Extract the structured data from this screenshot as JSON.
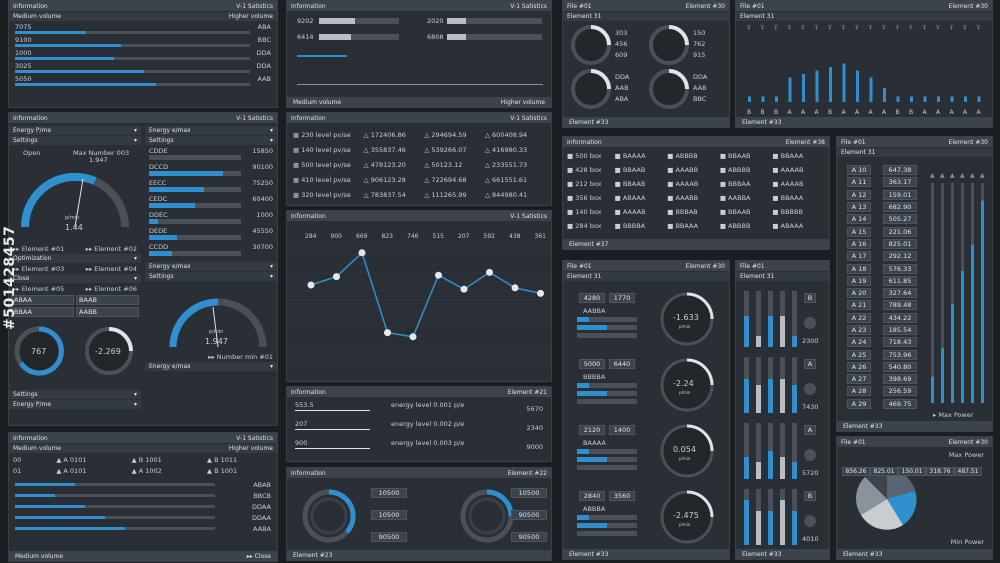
{
  "theme": {
    "accent": "#2f8fcf",
    "panel": "#2a2f35",
    "header": "#3c434b",
    "bg": "#1a1d21"
  },
  "p1": {
    "title": "Information",
    "tag": "V-1 Satistics",
    "sub_left": "Medium volume",
    "sub_right": "Higher volume",
    "foot_left": "Medium volume",
    "foot_right": "Higher volume",
    "rows": [
      {
        "label": "7075",
        "code": "ABA",
        "fill": 0.3
      },
      {
        "label": "9100",
        "code": "BBC",
        "fill": 0.45
      },
      {
        "label": "1000",
        "code": "DDA",
        "fill": 0.42
      },
      {
        "label": "3025",
        "code": "DDA",
        "fill": 0.55
      },
      {
        "label": "5050",
        "code": "AAB",
        "fill": 0.6
      }
    ]
  },
  "p2": {
    "title": "Information",
    "tag": "V-1 Satistics",
    "v1": "9202",
    "v2": "6414",
    "v3": "2020",
    "v4": "6808",
    "foot_left": "Medium volume",
    "foot_right": "Higher volume"
  },
  "p3": {
    "title": "File #01",
    "tag": "Element #30",
    "sub": "Element 31",
    "foot": "Element #33",
    "dials": [
      {
        "a": "303",
        "b": "456",
        "c": "609"
      },
      {
        "a": "150",
        "b": "762",
        "c": "915"
      },
      {
        "a": "DDA",
        "b": "AAB",
        "c": "ABA"
      },
      {
        "a": "DDA",
        "b": "AAB",
        "c": "BBC"
      }
    ]
  },
  "p4": {
    "title": "File #01",
    "tag": "Element #30",
    "sub": "Element 31",
    "foot": "Element #33",
    "xlabels": [
      "B",
      "B",
      "B",
      "A",
      "A",
      "A",
      "B",
      "A",
      "A",
      "A",
      "A",
      "B",
      "B",
      "A",
      "A",
      "A",
      "A",
      "A"
    ],
    "values": [
      0.08,
      0.08,
      0.08,
      0.35,
      0.4,
      0.45,
      0.5,
      0.55,
      0.45,
      0.35,
      0.2,
      0.08,
      0.08,
      0.08,
      0.08,
      0.08,
      0.08,
      0.08
    ]
  },
  "p5": {
    "title": "Information",
    "tag": "V-1 Satistics",
    "energy_pme": "Energy P/me",
    "energy_emax": "Energy e/max",
    "settings": "Settings",
    "open": "Open",
    "max_label": "Max Number 003",
    "max_val": "1.947",
    "gauge_unit": "p/min",
    "gauge_val": "1.44",
    "el01": "Element #01",
    "el02": "Element #02",
    "optimization": "Optimization",
    "el03": "Element #03",
    "el04": "Element #04",
    "close": "Close",
    "el05": "Element #05",
    "el06": "Element #06",
    "codes": [
      "ABAA",
      "BAAB",
      "BBAA",
      "AABB"
    ],
    "dial1": "767",
    "dial2": "-2.269",
    "settings2": "Settings",
    "energy_pme2": "Energy P/me",
    "list": [
      {
        "label": "CDDE",
        "val": "15850",
        "fill": 0.0
      },
      {
        "label": "DCCD",
        "val": "90100",
        "fill": 0.8
      },
      {
        "label": "EECC",
        "val": "75250",
        "fill": 0.6
      },
      {
        "label": "CEDC",
        "val": "60400",
        "fill": 0.5
      },
      {
        "label": "DDEC",
        "val": "1000",
        "fill": 0.1
      },
      {
        "label": "DEDE",
        "val": "45550",
        "fill": 0.3
      },
      {
        "label": "CCDD",
        "val": "30700",
        "fill": 0.25
      }
    ],
    "gauge2_val": "1.947",
    "gauge2_unit": "p/min",
    "number_min": "Number min #01",
    "energy_emax2": "Energy e/max"
  },
  "p6": {
    "title": "Information",
    "tag": "V-1 Satistics",
    "rows": [
      {
        "a": "230",
        "a_unit": "level pv/se",
        "b": "172406.86",
        "c": "294694.59",
        "d": "600408.94"
      },
      {
        "a": "140",
        "a_unit": "level pv/se",
        "b": "355837.46",
        "c": "539266.07",
        "d": "416980.33"
      },
      {
        "a": "500",
        "a_unit": "level pv/se",
        "b": "478123.20",
        "c": "50123.12",
        "d": "233551.73"
      },
      {
        "a": "410",
        "a_unit": "level pv/se",
        "b": "906123.28",
        "c": "722694.68",
        "d": "661551.61"
      },
      {
        "a": "320",
        "a_unit": "level pv/se",
        "b": "783837.54",
        "c": "111265.99",
        "d": "844980.41"
      }
    ]
  },
  "p7": {
    "title": "Information",
    "tag": "V-1 Satistics"
  },
  "chart_data": {
    "type": "line",
    "categories": [
      "284",
      "900",
      "669",
      "823",
      "746",
      "515",
      "207",
      "592",
      "438",
      "361"
    ],
    "values": [
      0.55,
      0.61,
      0.78,
      0.21,
      0.18,
      0.62,
      0.52,
      0.64,
      0.53,
      0.49
    ],
    "ylim": [
      0,
      1
    ],
    "grid": true
  },
  "p8": {
    "title": "Information",
    "tag": "Element #21",
    "rows": [
      {
        "left": "553.5",
        "mid": "energy level 0.001 p/e",
        "right": "5670"
      },
      {
        "left": "207",
        "mid": "energy level 0.002 p/e",
        "right": "2340"
      },
      {
        "left": "900",
        "mid": "energy level 0.003 p/e",
        "right": "9000"
      }
    ]
  },
  "p9": {
    "title": "Information",
    "tag": "Element #22",
    "foot": "Element #23",
    "boxes": [
      "10500",
      "10500",
      "90500",
      "10500",
      "90500",
      "90500"
    ]
  },
  "p10": {
    "title": "Information",
    "tag": "Element #38",
    "foot": "Element #37",
    "rows": [
      [
        "500 box",
        "BAAAA",
        "ABBBB",
        "BBAAB",
        "BBAAA"
      ],
      [
        "428 box",
        "BBAAB",
        "AAABB",
        "ABBBB",
        "AAAAB"
      ],
      [
        "212 box",
        "BBAAB",
        "AAAAB",
        "BBBAA",
        "AAAAB"
      ],
      [
        "356 box",
        "ABAAA",
        "AAABB",
        "AABBA",
        "BBAAA"
      ],
      [
        "140 box",
        "AAAAB",
        "BBBAB",
        "BBAAB",
        "BBBBB"
      ],
      [
        "284 box",
        "BBBBA",
        "BBAAA",
        "ABBBB",
        "ABAAA"
      ]
    ]
  },
  "p11": {
    "title": "File #01",
    "tag": "Element #30",
    "sub": "Element 31",
    "foot": "Element #33",
    "groups": [
      {
        "a": "4280",
        "b": "1770",
        "code": "AABBA",
        "dial": "-1.633",
        "unit": "p/min"
      },
      {
        "a": "5000",
        "b": "6440",
        "code": "BBBBA",
        "dial": "-2.24",
        "unit": "p/min"
      },
      {
        "a": "2120",
        "b": "1400",
        "code": "BAAAA",
        "dial": "0.054",
        "unit": "p/min"
      },
      {
        "a": "2840",
        "b": "3560",
        "code": "ABBBA",
        "dial": "-2.475",
        "unit": "p/min"
      }
    ]
  },
  "p12": {
    "title": "File #01",
    "sub": "Element 31",
    "foot": "Element #33",
    "tags": [
      "B",
      "A",
      "A",
      "B"
    ],
    "values": [
      "2300",
      "7430",
      "5720",
      "4010"
    ]
  },
  "p13": {
    "title": "File #01",
    "tag": "Element #30",
    "sub": "Element 31",
    "foot": "Element #33",
    "legend": "Max Power",
    "rows": [
      {
        "k": "A 10",
        "v": "647.38"
      },
      {
        "k": "A 11",
        "v": "363.17"
      },
      {
        "k": "A 12",
        "v": "159.01"
      },
      {
        "k": "A 13",
        "v": "682.90"
      },
      {
        "k": "A 14",
        "v": "505.27"
      },
      {
        "k": "A 15",
        "v": "221.06"
      },
      {
        "k": "A 16",
        "v": "825.01"
      },
      {
        "k": "A 17",
        "v": "292.12"
      },
      {
        "k": "A 18",
        "v": "576.33"
      },
      {
        "k": "A 19",
        "v": "611.85"
      },
      {
        "k": "A 20",
        "v": "327.64"
      },
      {
        "k": "A 21",
        "v": "789.48"
      },
      {
        "k": "A 22",
        "v": "434.22"
      },
      {
        "k": "A 23",
        "v": "185.54"
      },
      {
        "k": "A 24",
        "v": "718.43"
      },
      {
        "k": "A 25",
        "v": "753.96"
      },
      {
        "k": "A 26",
        "v": "540.80"
      },
      {
        "k": "A 27",
        "v": "398.69"
      },
      {
        "k": "A 28",
        "v": "256.59"
      },
      {
        "k": "A 29",
        "v": "469.75"
      }
    ],
    "bars": [
      0.12,
      0.25,
      0.45,
      0.6,
      0.72,
      0.92
    ]
  },
  "p14": {
    "title": "File #01",
    "tag": "Element #30",
    "foot": "Element #33",
    "max": "Max Power",
    "min": "Min Power",
    "values": [
      "856.26",
      "825.01",
      "150.01",
      "318.76",
      "487.51"
    ]
  },
  "p15": {
    "title": "Information",
    "tag": "V-1 Satistics",
    "sub_left": "Medium volume",
    "sub_right": "Higher volume",
    "grid": [
      [
        "A 0101",
        "B 1001",
        "B 1011"
      ],
      [
        "A 0101",
        "A 1002",
        "B 1001"
      ]
    ],
    "grid_first": [
      "00",
      "01"
    ],
    "rows": [
      {
        "code": "ABAB",
        "fill": 0.3
      },
      {
        "code": "BBCB",
        "fill": 0.2
      },
      {
        "code": "DDAA",
        "fill": 0.35
      },
      {
        "code": "DDAA",
        "fill": 0.45
      },
      {
        "code": "AABA",
        "fill": 0.55
      }
    ],
    "foot_left": "Medium volume",
    "close": "Close"
  },
  "watermark": "#501428457"
}
